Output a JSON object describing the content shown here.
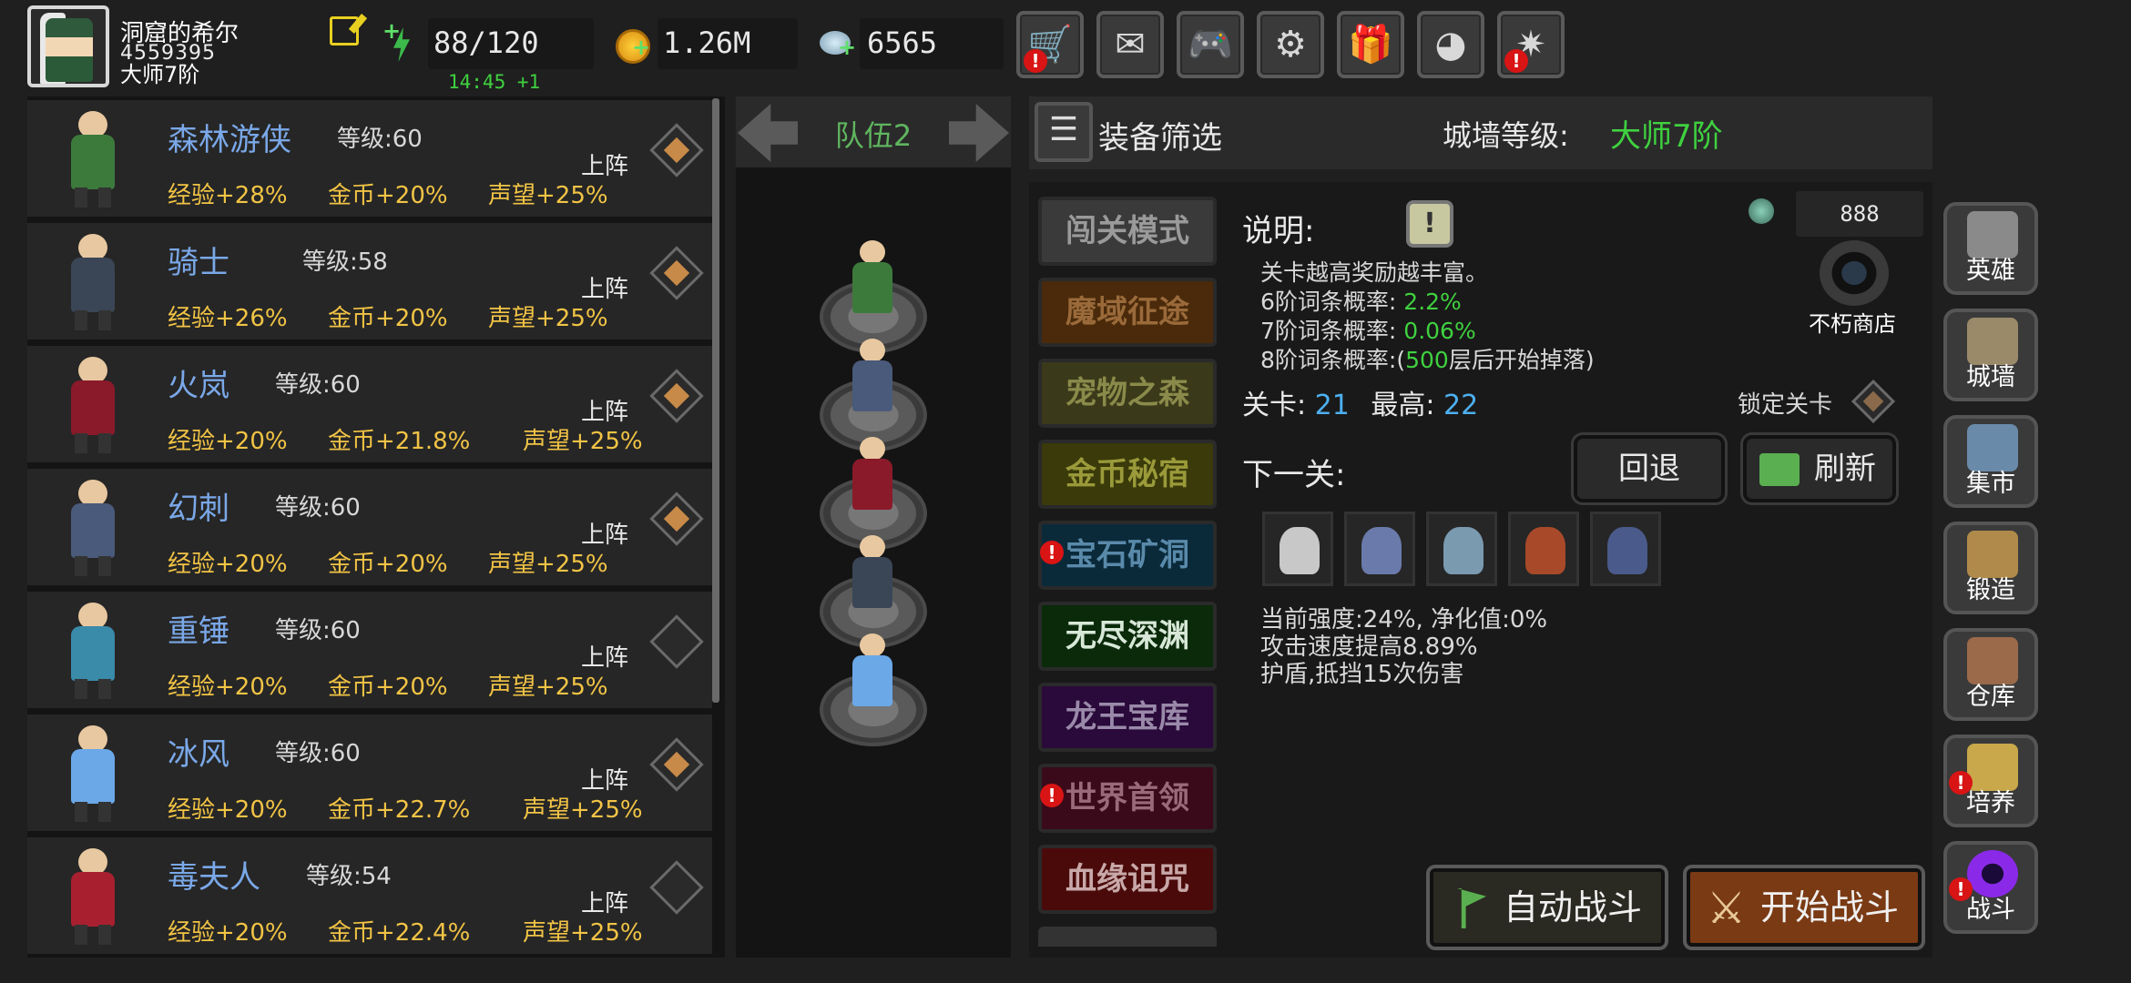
{
  "player": {
    "name": "洞窟的希尔",
    "id": "4559395",
    "rank": "大师7阶"
  },
  "resources": {
    "energy": "88/120",
    "energy_timer": "14:45 +1",
    "gold": "1.26M",
    "reputation": "6565"
  },
  "top_buttons": [
    {
      "name": "shop",
      "glyph": "🛒",
      "alert": true
    },
    {
      "name": "mail",
      "glyph": "✉",
      "alert": false
    },
    {
      "name": "gamepad",
      "glyph": "🎮",
      "alert": false
    },
    {
      "name": "settings",
      "glyph": "⚙",
      "alert": false
    },
    {
      "name": "gift",
      "glyph": "🎁",
      "alert": false
    },
    {
      "name": "wheel",
      "glyph": "◕",
      "alert": false
    },
    {
      "name": "fireworks",
      "glyph": "✷",
      "alert": true
    }
  ],
  "heroes": [
    {
      "name": "森林游侠",
      "level_label": "等级:60",
      "exp": "经验+28%",
      "gold": "金币+20%",
      "rep": "声望+25%",
      "deploy": "上阵",
      "active": true,
      "color": "#3c7a3c"
    },
    {
      "name": "骑士",
      "level_label": "等级:58",
      "exp": "经验+26%",
      "gold": "金币+20%",
      "rep": "声望+25%",
      "deploy": "上阵",
      "active": true,
      "color": "#3a4656"
    },
    {
      "name": "火岚",
      "level_label": "等级:60",
      "exp": "经验+20%",
      "gold": "金币+21.8%",
      "rep": "声望+25%",
      "deploy": "上阵",
      "active": true,
      "color": "#8a1a2a"
    },
    {
      "name": "幻刺",
      "level_label": "等级:60",
      "exp": "经验+20%",
      "gold": "金币+20%",
      "rep": "声望+25%",
      "deploy": "上阵",
      "active": true,
      "color": "#4a5a7a"
    },
    {
      "name": "重锤",
      "level_label": "等级:60",
      "exp": "经验+20%",
      "gold": "金币+20%",
      "rep": "声望+25%",
      "deploy": "上阵",
      "active": false,
      "color": "#3a8aaa"
    },
    {
      "name": "冰风",
      "level_label": "等级:60",
      "exp": "经验+20%",
      "gold": "金币+22.7%",
      "rep": "声望+25%",
      "deploy": "上阵",
      "active": true,
      "color": "#6aa8e8"
    },
    {
      "name": "毒夫人",
      "level_label": "等级:54",
      "exp": "经验+20%",
      "gold": "金币+22.4%",
      "rep": "声望+25%",
      "deploy": "上阵",
      "active": false,
      "color": "#a82030"
    }
  ],
  "team": {
    "label": "队伍2",
    "members": [
      "#3c7a3c",
      "#4a5a7a",
      "#8a1a2a",
      "#3a4656",
      "#6aa8e8"
    ]
  },
  "filter": {
    "label": "装备筛选",
    "wall_label": "城墙等级:",
    "wall_value": "大师7阶"
  },
  "modes": [
    {
      "label": "闯关模式",
      "bg": "#3a3a3a",
      "color": "#9a9a9a",
      "alert": false
    },
    {
      "label": "魔域征途",
      "bg": "#4a2a0a",
      "color": "#9a6a3a",
      "alert": false
    },
    {
      "label": "宠物之森",
      "bg": "#3a3a1a",
      "color": "#8a8a4a",
      "alert": false
    },
    {
      "label": "金币秘宿",
      "bg": "#3a3a0a",
      "color": "#9a9a3a",
      "alert": false
    },
    {
      "label": "宝石矿洞",
      "bg": "#0a2a3a",
      "color": "#5a8aaa",
      "alert": true
    },
    {
      "label": "无尽深渊",
      "bg": "#0a2a0a",
      "color": "#d8e8d8",
      "alert": false
    },
    {
      "label": "龙王宝库",
      "bg": "#2a0a3a",
      "color": "#9a8aaa",
      "alert": false
    },
    {
      "label": "世界首领",
      "bg": "#3a0a1a",
      "color": "#9a6a7a",
      "alert": true
    },
    {
      "label": "血缘诅咒",
      "bg": "#4a0a0a",
      "color": "#c8a8a8",
      "alert": false
    }
  ],
  "info": {
    "title": "说明:",
    "line1": "关卡越高奖励越丰富。",
    "p6_label": "6阶词条概率:",
    "p6_val": "2.2%",
    "p7_label": "7阶词条概率:",
    "p7_val": "0.06%",
    "p8_label": "8阶词条概率:(",
    "p8_val": "500",
    "p8_tail": "层后开始掉落)",
    "gem_count": "888",
    "shop_label": "不朽商店",
    "lock_label": "锁定关卡",
    "stage_label": "关卡:",
    "stage_val": "21",
    "best_label": "最高:",
    "best_val": "22",
    "next_label": "下一关:",
    "back_label": "回退",
    "refresh_label": "刷新",
    "monsters": [
      "#c8c8c8",
      "#6a7aaa",
      "#7a9ab0",
      "#a84a2a",
      "#4a5a8a"
    ],
    "cond1": "当前强度:24%, 净化值:0%",
    "cond2": "攻击速度提高8.89%",
    "cond3": "护盾,抵挡15次伤害",
    "auto_label": "自动战斗",
    "start_label": "开始战斗"
  },
  "sidebar": [
    {
      "label": "英雄",
      "art": "#8a8a8a",
      "alert": false
    },
    {
      "label": "城墙",
      "art": "#9a8a6a",
      "alert": false
    },
    {
      "label": "集市",
      "art": "#6a8aaa",
      "alert": false
    },
    {
      "label": "锻造",
      "art": "#b08a4a",
      "alert": false
    },
    {
      "label": "仓库",
      "art": "#9a6a4a",
      "alert": false
    },
    {
      "label": "培养",
      "art": "#c8a84a",
      "alert": true
    },
    {
      "label": "战斗",
      "art": "#8a2ae8",
      "alert": true
    }
  ]
}
